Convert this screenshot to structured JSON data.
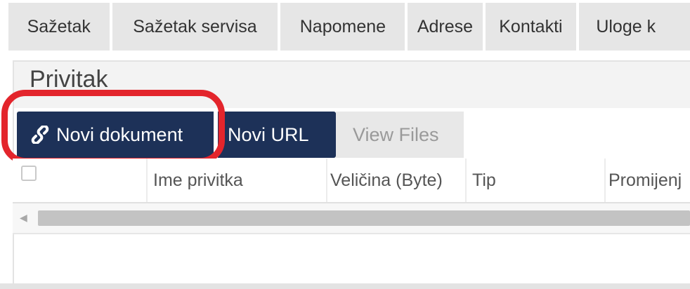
{
  "tabs": [
    {
      "label": "Sažetak"
    },
    {
      "label": "Sažetak servisa"
    },
    {
      "label": "Napomene"
    },
    {
      "label": "Adrese"
    },
    {
      "label": "Kontakti"
    },
    {
      "label": "Uloge k"
    }
  ],
  "panel": {
    "title": "Privitak"
  },
  "toolbar": {
    "new_document_label": "Novi dokument",
    "new_document_icon": "link-icon",
    "new_url_label": "Novi URL",
    "view_files_label": "View Files"
  },
  "table": {
    "columns": [
      "",
      "Ime privitka",
      "Veličina (Byte)",
      "Tip",
      "Promijenj"
    ]
  },
  "colors": {
    "button_primary": "#1d3158",
    "highlight": "#e3252c"
  }
}
